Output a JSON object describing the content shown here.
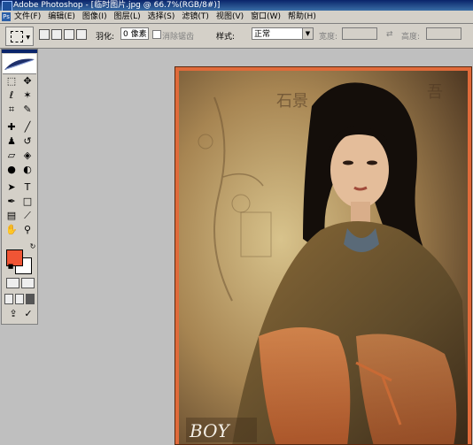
{
  "window": {
    "title": "Adobe Photoshop - [临时图片.jpg @ 66.7%(RGB/8#)]"
  },
  "menu": {
    "items": [
      "文件(F)",
      "编辑(E)",
      "图像(I)",
      "图层(L)",
      "选择(S)",
      "滤镜(T)",
      "视图(V)",
      "窗口(W)",
      "帮助(H)"
    ]
  },
  "options": {
    "feather_label": "羽化:",
    "feather_value": "0 像素",
    "antialias_label": "消除锯齿",
    "style_label": "样式:",
    "style_value": "正常",
    "width_label": "宽度:",
    "height_label": "高度:"
  },
  "toolbox": {
    "foreground_color": "#f05535",
    "background_color": "#ffffff"
  },
  "document": {
    "signature": "BOY"
  }
}
